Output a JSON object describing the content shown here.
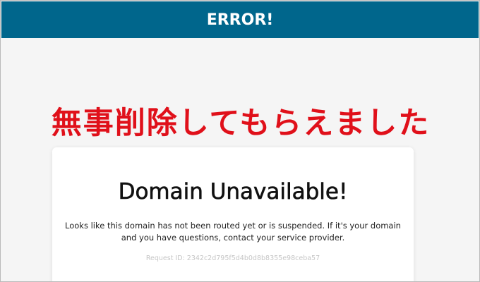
{
  "header": {
    "title": "ERROR!"
  },
  "overlay": {
    "text": "無事削除してもらえました"
  },
  "card": {
    "title": "Domain Unavailable!",
    "message": "Looks like this domain has not been routed yet or is suspended. If it's your domain and you have questions, contact your service provider.",
    "request_id": "Request ID: 2342c2d795f5d4b0d8b8355e98ceba57"
  },
  "colors": {
    "header_bg": "#00668c",
    "overlay_text": "#e0101a",
    "page_bg": "#f5f5f5",
    "card_bg": "#ffffff"
  }
}
